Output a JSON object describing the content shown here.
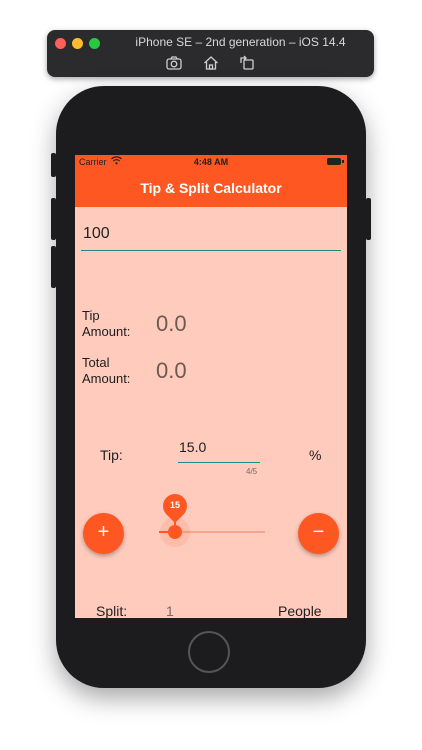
{
  "simulator": {
    "title": "iPhone SE – 2nd generation – iOS 14.4",
    "toolbar_icons": [
      "screenshot-icon",
      "home-icon",
      "rotate-icon"
    ]
  },
  "status_bar": {
    "carrier": "Carrier",
    "time": "4:48 AM"
  },
  "app_bar": {
    "title": "Tip & Split Calculator"
  },
  "bill": {
    "value": "100"
  },
  "results": {
    "tip_label_line1": "Tip",
    "tip_label_line2": "Amount:",
    "tip_value": "0.0",
    "total_label_line1": "Total",
    "total_label_line2": "Amount:",
    "total_value": "0.0"
  },
  "tip": {
    "label": "Tip:",
    "value": "15.0",
    "counter": "4/5",
    "unit": "%"
  },
  "slider": {
    "value": "15",
    "fraction": 0.15
  },
  "buttons": {
    "increase": "+",
    "decrease": "−"
  },
  "split": {
    "label": "Split:",
    "value": "1",
    "unit": "People"
  },
  "colors": {
    "accent": "#fe5722",
    "screen_background": "#fecbbd",
    "underline": "#1f8b80"
  }
}
